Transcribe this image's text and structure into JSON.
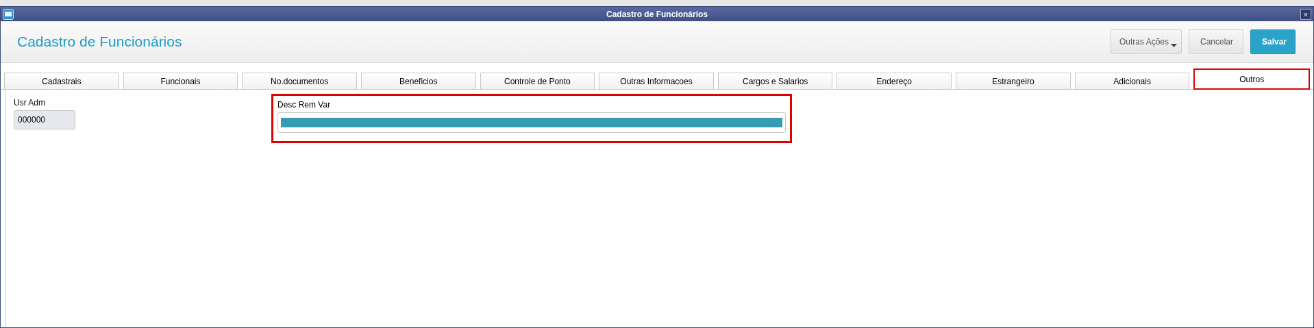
{
  "window": {
    "title": "Cadastro de Funcionários",
    "close": "×"
  },
  "header": {
    "title": "Cadastro de Funcionários",
    "buttons": [
      {
        "label": "Outras Ações",
        "kind": "dropdown"
      },
      {
        "label": "Cancelar",
        "kind": "plain"
      },
      {
        "label": "Salvar",
        "kind": "primary"
      }
    ]
  },
  "tabs": [
    {
      "label": "Cadastrais",
      "selected": false
    },
    {
      "label": "Funcionais",
      "selected": false
    },
    {
      "label": "No.documentos",
      "selected": false
    },
    {
      "label": "Beneficios",
      "selected": false
    },
    {
      "label": "Controle de Ponto",
      "selected": false
    },
    {
      "label": "Outras Informacoes",
      "selected": false
    },
    {
      "label": "Cargos e Salarios",
      "selected": false
    },
    {
      "label": "Endereço",
      "selected": false
    },
    {
      "label": "Estrangeiro",
      "selected": false
    },
    {
      "label": "Adicionais",
      "selected": false
    },
    {
      "label": "Outros",
      "selected": true
    }
  ],
  "fields": [
    {
      "label": "Usr Adm",
      "value": "000000",
      "disabled": true
    },
    {
      "label": "Desc Rem Var",
      "level": 1
    }
  ]
}
